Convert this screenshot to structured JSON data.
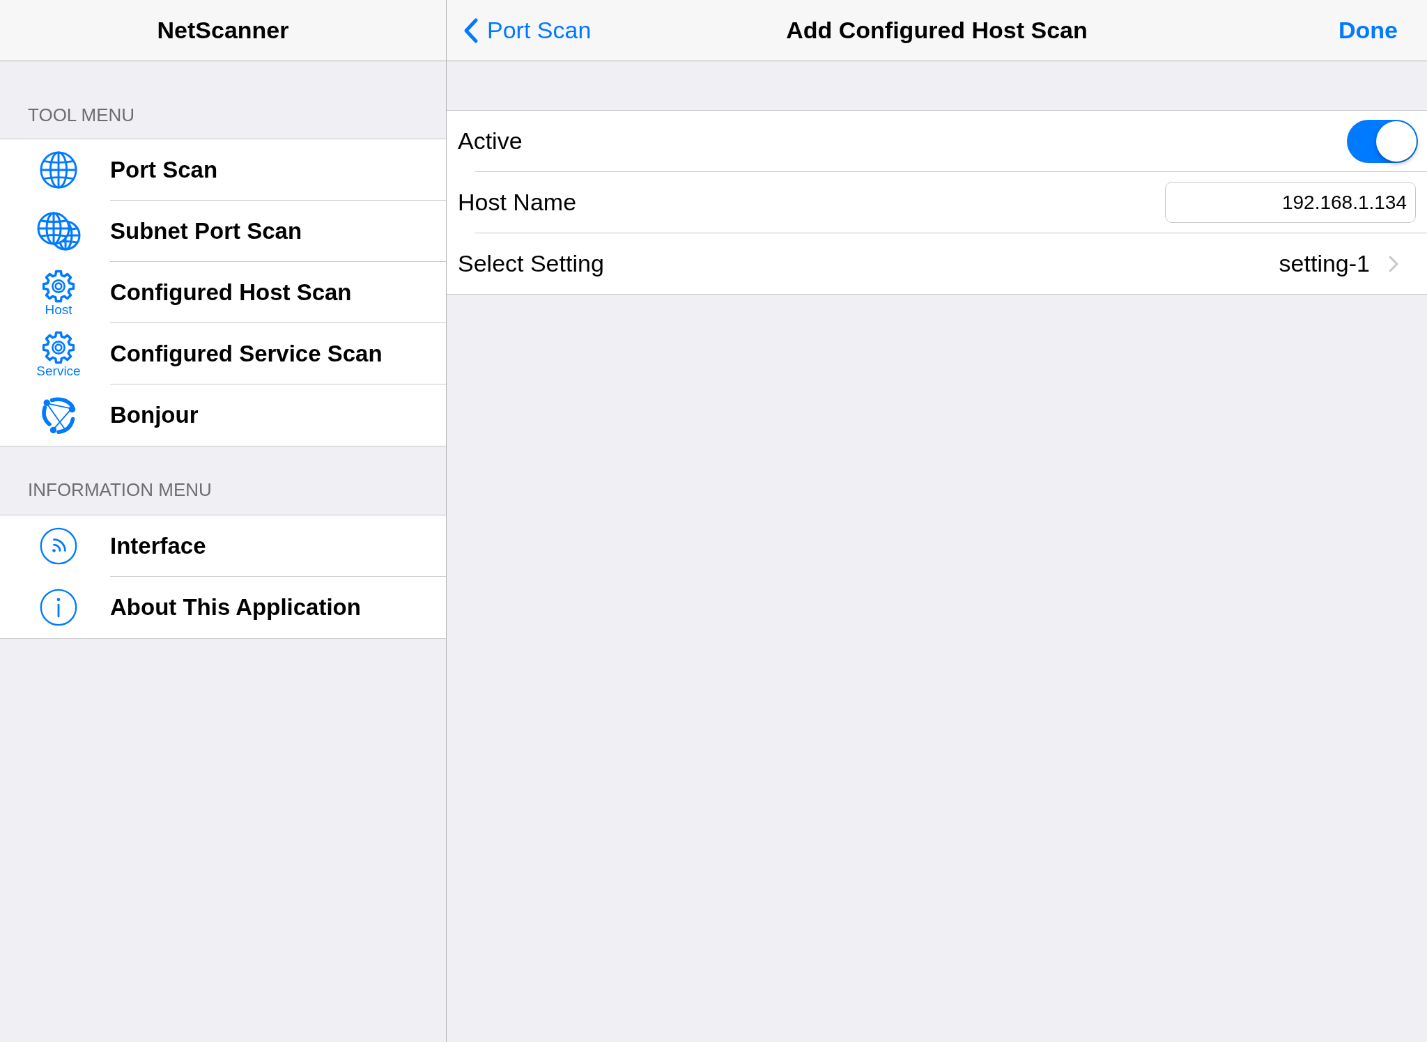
{
  "sidebar": {
    "title": "NetScanner",
    "sections": [
      {
        "header": "TOOL MENU",
        "items": [
          {
            "label": "Port Scan",
            "kind": "globe"
          },
          {
            "label": "Subnet Port Scan",
            "kind": "globes"
          },
          {
            "label": "Configured Host Scan",
            "kind": "gear",
            "icon_caption": "Host"
          },
          {
            "label": "Configured Service Scan",
            "kind": "gear",
            "icon_caption": "Service"
          },
          {
            "label": "Bonjour",
            "kind": "bonjour"
          }
        ]
      },
      {
        "header": "INFORMATION MENU",
        "items": [
          {
            "label": "Interface",
            "kind": "signal"
          },
          {
            "label": "About This Application",
            "kind": "info"
          }
        ]
      }
    ]
  },
  "nav_bar": {
    "back": "Port Scan",
    "title": "Add Configured Host Scan",
    "action": "Done"
  },
  "form": {
    "rows": [
      {
        "kind": "toggle",
        "label": "Active",
        "on": true
      },
      {
        "kind": "text_field",
        "label": "Host Name",
        "value": "192.168.1.134"
      },
      {
        "kind": "disclosure",
        "label": "Select Setting",
        "value": "setting-1"
      }
    ]
  }
}
